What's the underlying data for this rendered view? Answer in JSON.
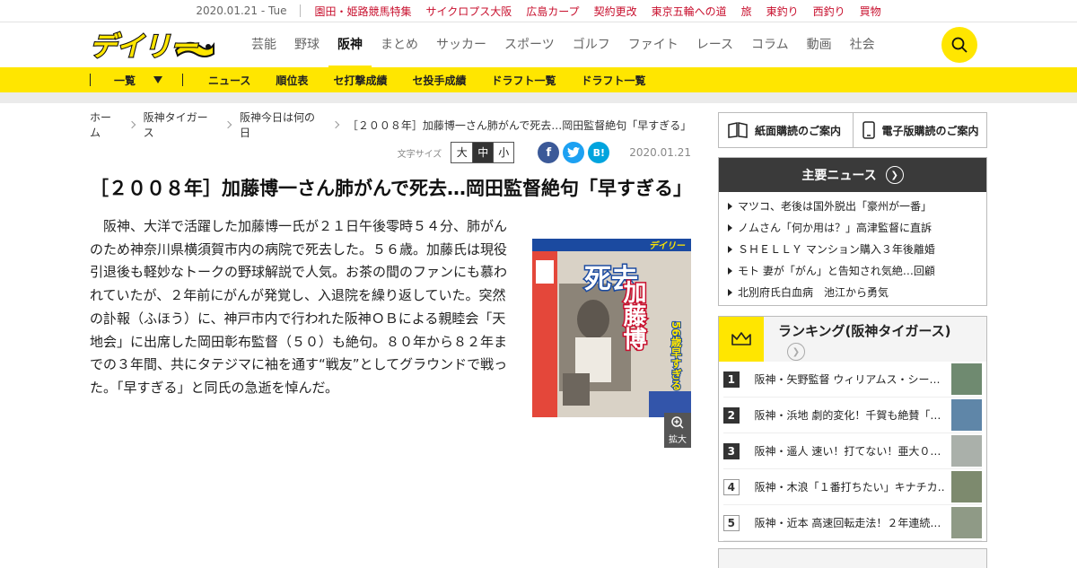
{
  "topbar": {
    "date": "2020.01.21 - Tue",
    "links": [
      "園田・姫路競馬特集",
      "サイクロプス大阪",
      "広島カープ",
      "契約更改",
      "東京五輪への道",
      "旅",
      "東釣り",
      "西釣り",
      "買物"
    ]
  },
  "header": {
    "logo_text": "デイリー",
    "nav": [
      "芸能",
      "野球",
      "阪神",
      "まとめ",
      "サッカー",
      "スポーツ",
      "ゴルフ",
      "ファイト",
      "レース",
      "コラム",
      "動画",
      "社会"
    ],
    "active_nav": "阪神"
  },
  "subnav": {
    "ichiran": "一覧",
    "links": [
      "ニュース",
      "順位表",
      "セ打撃成績",
      "セ投手成績",
      "ドラフト一覧",
      "ドラフト一覧"
    ]
  },
  "breadcrumb": [
    "ホーム",
    "阪神タイガース",
    "阪神今日は何の日",
    "［２００８年］加藤博一さん肺がんで死去…岡田監督絶句「早すぎる」"
  ],
  "tools": {
    "font_size_label": "文字サイズ",
    "sizes": [
      "大",
      "中",
      "小"
    ],
    "selected_size": "中",
    "share": {
      "facebook": "f",
      "twitter": "t",
      "hatena": "B!"
    },
    "date": "2020.01.21"
  },
  "article": {
    "title": "［２００８年］加藤博一さん肺がんで死去…岡田監督絶句「早すぎる」",
    "body": "阪神、大洋で活躍した加藤博一氏が２１日午後零時５４分、肺がんのため神奈川県横須賀市内の病院で死去した。５６歳。加藤氏は現役引退後も軽妙なトークの野球解説で人気。お茶の間のファンにも慕われていたが、２年前にがんが発覚し、入退院を繰り返していた。突然の訃報（ふほう）に、神戸市内で行われた阪神ＯＢによる親睦会「天地会」に出席した岡田彰布監督（５０）も絶句。８０年から８２年までの３年間、共にタテジマに袖を通す“戦友”としてグラウンドで戦った。「早すぎる」と同氏の急逝を悼んだ。",
    "photo": {
      "logo": "デイリー",
      "headline_big1": "死去",
      "headline_big2": "加藤博",
      "side_text": "56歳早すぎる",
      "enlarge_label": "拡大"
    }
  },
  "sidebar": {
    "subscribe": [
      "紙面購読のご案内",
      "電子版購読のご案内"
    ],
    "major_news": {
      "title": "主要ニュース",
      "items": [
        "マツコ、老後は国外脱出「豪州が一番」",
        "ノムさん「何か用は？」高津監督に直訴",
        "ＳＨＥＬＬＹ マンション購入３年後離婚",
        "モト 妻が「がん」と告知され気絶…回顧",
        "北別府氏白血病　池江から勇気"
      ]
    },
    "ranking": {
      "title": "ランキング(阪神タイガース)",
      "items": [
        {
          "rank": "1",
          "text": "阪神・矢野監督 ウィリアムス・シー…"
        },
        {
          "rank": "2",
          "text": "阪神・浜地 劇的変化！千賀も絶賛「…"
        },
        {
          "rank": "3",
          "text": "阪神・遥人 速い！打てない！亜大０…"
        },
        {
          "rank": "4",
          "text": "阪神・木浪「１番打ちたい」キナチカ…"
        },
        {
          "rank": "5",
          "text": "阪神・近本 高速回転走法！２年連続…"
        }
      ]
    }
  },
  "colors": {
    "brand_yellow": "#ffe600",
    "link_red": "#c8102e",
    "dark": "#3a3a3a"
  }
}
